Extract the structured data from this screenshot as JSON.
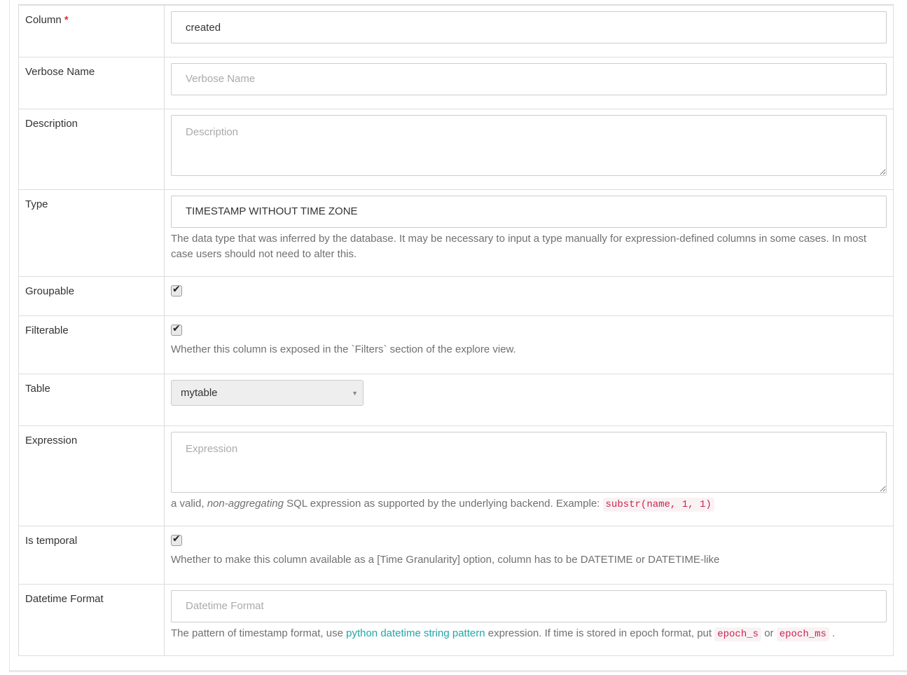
{
  "fields": {
    "column": {
      "label": "Column",
      "required_mark": "*",
      "value": "created"
    },
    "verbose_name": {
      "label": "Verbose Name",
      "placeholder": "Verbose Name"
    },
    "description": {
      "label": "Description",
      "placeholder": "Description"
    },
    "type": {
      "label": "Type",
      "value": "TIMESTAMP WITHOUT TIME ZONE",
      "help": "The data type that was inferred by the database. It may be necessary to input a type manually for expression-defined columns in some cases. In most case users should not need to alter this."
    },
    "groupable": {
      "label": "Groupable",
      "checked": true
    },
    "filterable": {
      "label": "Filterable",
      "checked": true,
      "help": "Whether this column is exposed in the `Filters` section of the explore view."
    },
    "table": {
      "label": "Table",
      "selected": "mytable"
    },
    "expression": {
      "label": "Expression",
      "placeholder": "Expression",
      "help_prefix": "a valid, ",
      "help_em": "non-aggregating",
      "help_mid": " SQL expression as supported by the underlying backend. Example: ",
      "help_code": "substr(name, 1, 1)"
    },
    "is_temporal": {
      "label": "Is temporal",
      "checked": true,
      "help": "Whether to make this column available as a [Time Granularity] option, column has to be DATETIME or DATETIME-like"
    },
    "datetime_format": {
      "label": "Datetime Format",
      "placeholder": "Datetime Format",
      "help_prefix": "The pattern of timestamp format, use ",
      "help_link": "python datetime string pattern",
      "help_mid": " expression. If time is stored in epoch format, put ",
      "code_1": "epoch_s",
      "help_or": " or ",
      "code_2": "epoch_ms",
      "help_end": " ."
    }
  },
  "icons": {
    "checkbox_mark": "checkmark-icon",
    "select_caret": "caret-down-icon",
    "textarea_resize": "resize-handle-icon"
  },
  "colors": {
    "required": "#e0312f",
    "link": "#20a7a7",
    "code": "#c7254e",
    "code_bg": "#f9f2f4"
  }
}
